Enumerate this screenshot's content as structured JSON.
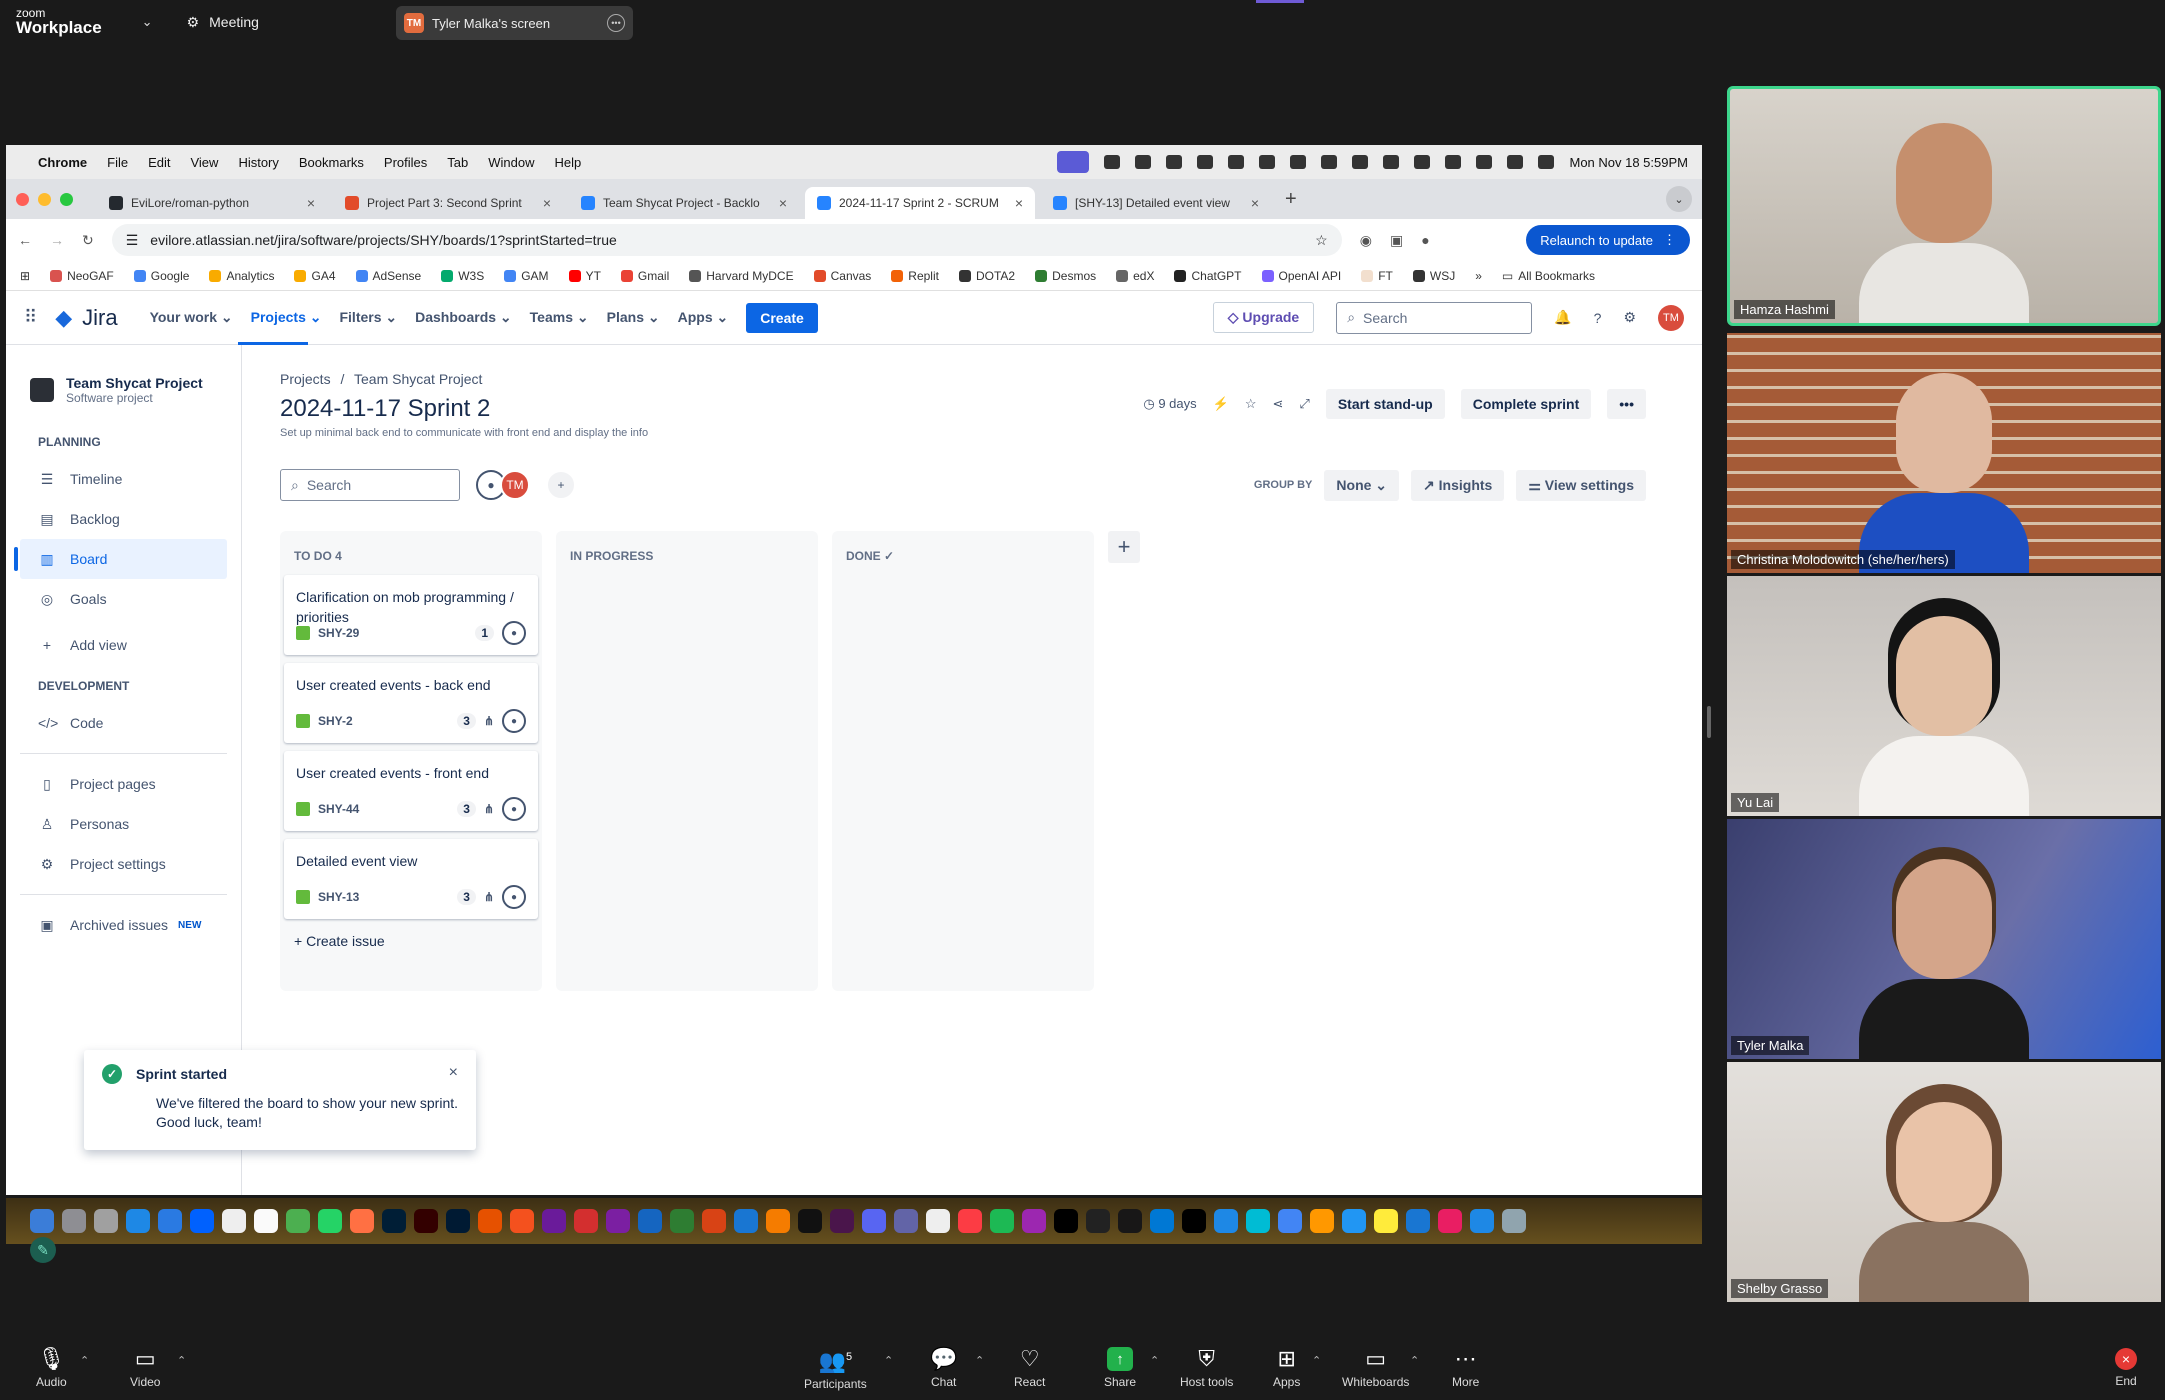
{
  "zoom": {
    "logo_small": "zoom",
    "logo_big": "Workplace",
    "meeting_label": "Meeting",
    "screen_initials": "TM",
    "screen_label": "Tyler Malka's screen",
    "bottom": {
      "audio": "Audio",
      "video": "Video",
      "participants": "Participants",
      "participants_count": "5",
      "chat": "Chat",
      "react": "React",
      "share": "Share",
      "host_tools": "Host tools",
      "apps": "Apps",
      "whiteboards": "Whiteboards",
      "more": "More",
      "end": "End"
    },
    "participants": [
      {
        "name": "Hamza Hashmi"
      },
      {
        "name": "Christina Molodowitch (she/her/hers)"
      },
      {
        "name": "Yu Lai"
      },
      {
        "name": "Tyler Malka"
      },
      {
        "name": "Shelby Grasso"
      }
    ]
  },
  "mac": {
    "app": "Chrome",
    "menus": [
      "File",
      "Edit",
      "View",
      "History",
      "Bookmarks",
      "Profiles",
      "Tab",
      "Window",
      "Help"
    ],
    "clock": "Mon Nov 18  5:59PM"
  },
  "chrome": {
    "tabs": [
      {
        "title": "EviLore/roman-python",
        "color": "#24292f"
      },
      {
        "title": "Project Part 3: Second Sprint",
        "color": "#e24b2a"
      },
      {
        "title": "Team Shycat Project - Backlo",
        "color": "#2684ff"
      },
      {
        "title": "2024-11-17 Sprint 2 - SCRUM",
        "color": "#2684ff"
      },
      {
        "title": "[SHY-13] Detailed event view",
        "color": "#2684ff"
      }
    ],
    "url": "evilore.atlassian.net/jira/software/projects/SHY/boards/1?sprintStarted=true",
    "relaunch": "Relaunch to update",
    "bookmarks": [
      "NeoGAF",
      "Google",
      "Analytics",
      "GA4",
      "AdSense",
      "W3S",
      "GAM",
      "YT",
      "Gmail",
      "Harvard MyDCE",
      "Canvas",
      "Replit",
      "DOTA2",
      "Desmos",
      "edX",
      "ChatGPT",
      "OpenAI API",
      "FT",
      "WSJ"
    ],
    "all_bookmarks": "All Bookmarks"
  },
  "jira": {
    "logo": "Jira",
    "nav": [
      "Your work",
      "Projects",
      "Filters",
      "Dashboards",
      "Teams",
      "Plans",
      "Apps"
    ],
    "create": "Create",
    "upgrade": "Upgrade",
    "search_placeholder": "Search",
    "user_initials": "TM",
    "project_name": "Team Shycat Project",
    "project_type": "Software project",
    "planning_label": "PLANNING",
    "planning_items": [
      "Timeline",
      "Backlog",
      "Board",
      "Goals"
    ],
    "add_view": "Add view",
    "development_label": "DEVELOPMENT",
    "code": "Code",
    "project_pages": "Project pages",
    "personas": "Personas",
    "project_settings": "Project settings",
    "archived": "Archived issues",
    "new_badge": "NEW",
    "breadcrumb_root": "Projects",
    "breadcrumb_project": "Team Shycat Project",
    "sprint_title": "2024-11-17 Sprint 2",
    "sprint_goal": "Set up minimal back end to communicate with front end and display the info",
    "days": "9 days",
    "standup": "Start stand-up",
    "complete": "Complete sprint",
    "board_search": "Search",
    "group_by": "GROUP BY",
    "group_value": "None",
    "insights": "Insights",
    "view_settings": "View settings",
    "columns": [
      {
        "title": "TO DO 4",
        "cards": [
          {
            "title": "Clarification on mob programming / priorities",
            "key": "SHY-29",
            "count": "1",
            "subtask": false
          },
          {
            "title": "User created events - back end",
            "key": "SHY-2",
            "count": "3",
            "subtask": true
          },
          {
            "title": "User created events - front end",
            "key": "SHY-44",
            "count": "3",
            "subtask": true
          },
          {
            "title": "Detailed event view",
            "key": "SHY-13",
            "count": "3",
            "subtask": true
          }
        ]
      },
      {
        "title": "IN PROGRESS",
        "cards": []
      },
      {
        "title": "DONE",
        "cards": []
      }
    ],
    "create_issue": "Create issue",
    "toast_title": "Sprint started",
    "toast_text": "We've filtered the board to show your new sprint. Good luck, team!"
  }
}
